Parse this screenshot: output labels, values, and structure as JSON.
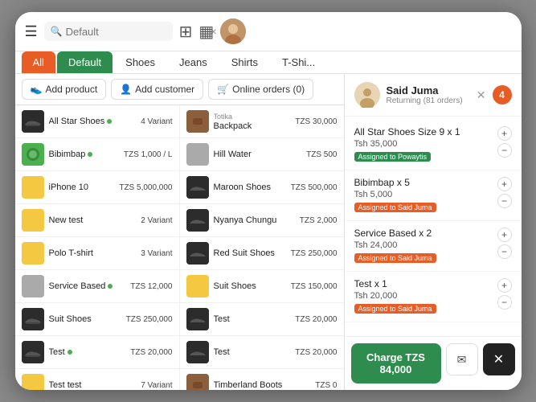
{
  "topbar": {
    "search_placeholder": "Default",
    "clear_label": "×"
  },
  "tabs": [
    {
      "id": "all",
      "label": "All",
      "active": true,
      "style": "active"
    },
    {
      "id": "default",
      "label": "Default",
      "style": "green"
    },
    {
      "id": "shoes",
      "label": "Shoes",
      "style": "normal"
    },
    {
      "id": "jeans",
      "label": "Jeans",
      "style": "normal"
    },
    {
      "id": "shirts",
      "label": "Shirts",
      "style": "normal"
    },
    {
      "id": "tshi",
      "label": "T-Shi...",
      "style": "normal"
    }
  ],
  "actions": {
    "add_product": "Add product",
    "add_customer": "Add customer",
    "online_orders": "Online orders (0)"
  },
  "products_left": [
    {
      "name": "All Star Shoes",
      "dot": true,
      "meta": "",
      "price": "4 Variant",
      "color": "shoe-dark"
    },
    {
      "name": "Bibimbap",
      "dot": true,
      "meta": "",
      "price": "TZS 1,000 / L",
      "color": "green-food"
    },
    {
      "name": "iPhone 10",
      "dot": false,
      "meta": "",
      "price": "TZS 5,000,000",
      "color": "yellow-box"
    },
    {
      "name": "New test",
      "dot": false,
      "meta": "",
      "price": "2 Variant",
      "color": "yellow-box"
    },
    {
      "name": "Polo T-shirt",
      "dot": false,
      "meta": "",
      "price": "3 Variant",
      "color": "yellow-box"
    },
    {
      "name": "Service Based",
      "dot": true,
      "meta": "",
      "price": "TZS 12,000",
      "color": "gray-box"
    },
    {
      "name": "Suit Shoes",
      "dot": false,
      "meta": "",
      "price": "TZS 250,000",
      "color": "shoe-dark"
    },
    {
      "name": "Test",
      "dot": true,
      "meta": "",
      "price": "TZS 20,000",
      "color": "shoe-dark"
    },
    {
      "name": "Test test",
      "dot": false,
      "meta": "",
      "price": "7 Variant",
      "color": "yellow-box"
    }
  ],
  "products_right": [
    {
      "name": "Backpack",
      "meta": "Totika",
      "price": "TZS 30,000",
      "color": "brown-box"
    },
    {
      "name": "Hill Water",
      "meta": "",
      "price": "TZS 500",
      "color": "gray-box"
    },
    {
      "name": "Maroon Shoes",
      "meta": "",
      "price": "TZS 500,000",
      "color": "shoe-dark"
    },
    {
      "name": "Nyanya Chungu",
      "meta": "",
      "price": "TZS 2,000",
      "color": "shoe-dark"
    },
    {
      "name": "Red Suit Shoes",
      "meta": "",
      "price": "TZS 250,000",
      "color": "shoe-dark"
    },
    {
      "name": "Suit Shoes",
      "meta": "",
      "price": "TZS 150,000",
      "color": "yellow-box"
    },
    {
      "name": "Test",
      "meta": "",
      "price": "TZS 20,000",
      "color": "shoe-dark"
    },
    {
      "name": "Test",
      "meta": "",
      "price": "TZS 20,000",
      "color": "shoe-dark"
    },
    {
      "name": "Timberland Boots",
      "meta": "",
      "price": "TZS 0",
      "color": "brown-box"
    }
  ],
  "customer": {
    "name": "Said Juma",
    "subtitle": "Returning (81 orders)",
    "cart_count": "4"
  },
  "cart_items": [
    {
      "name": "All Star Shoes Size 9 x 1",
      "price": "Tsh 35,000",
      "tag": "Assigned to Powaytis",
      "tag_style": "green"
    },
    {
      "name": "Bibimbap x 5",
      "price": "Tsh 5,000",
      "tag": "Assigned to Said Juma",
      "tag_style": "orange"
    },
    {
      "name": "Service Based x 2",
      "price": "Tsh 24,000",
      "tag": "Assigned to Said Juma",
      "tag_style": "orange"
    },
    {
      "name": "Test x 1",
      "price": "Tsh 20,000",
      "tag": "Assigned to Said Juma",
      "tag_style": "orange"
    }
  ],
  "bottom": {
    "charge_label": "Charge TZS 84,000",
    "email_icon": "✉",
    "cancel_icon": "✕"
  }
}
